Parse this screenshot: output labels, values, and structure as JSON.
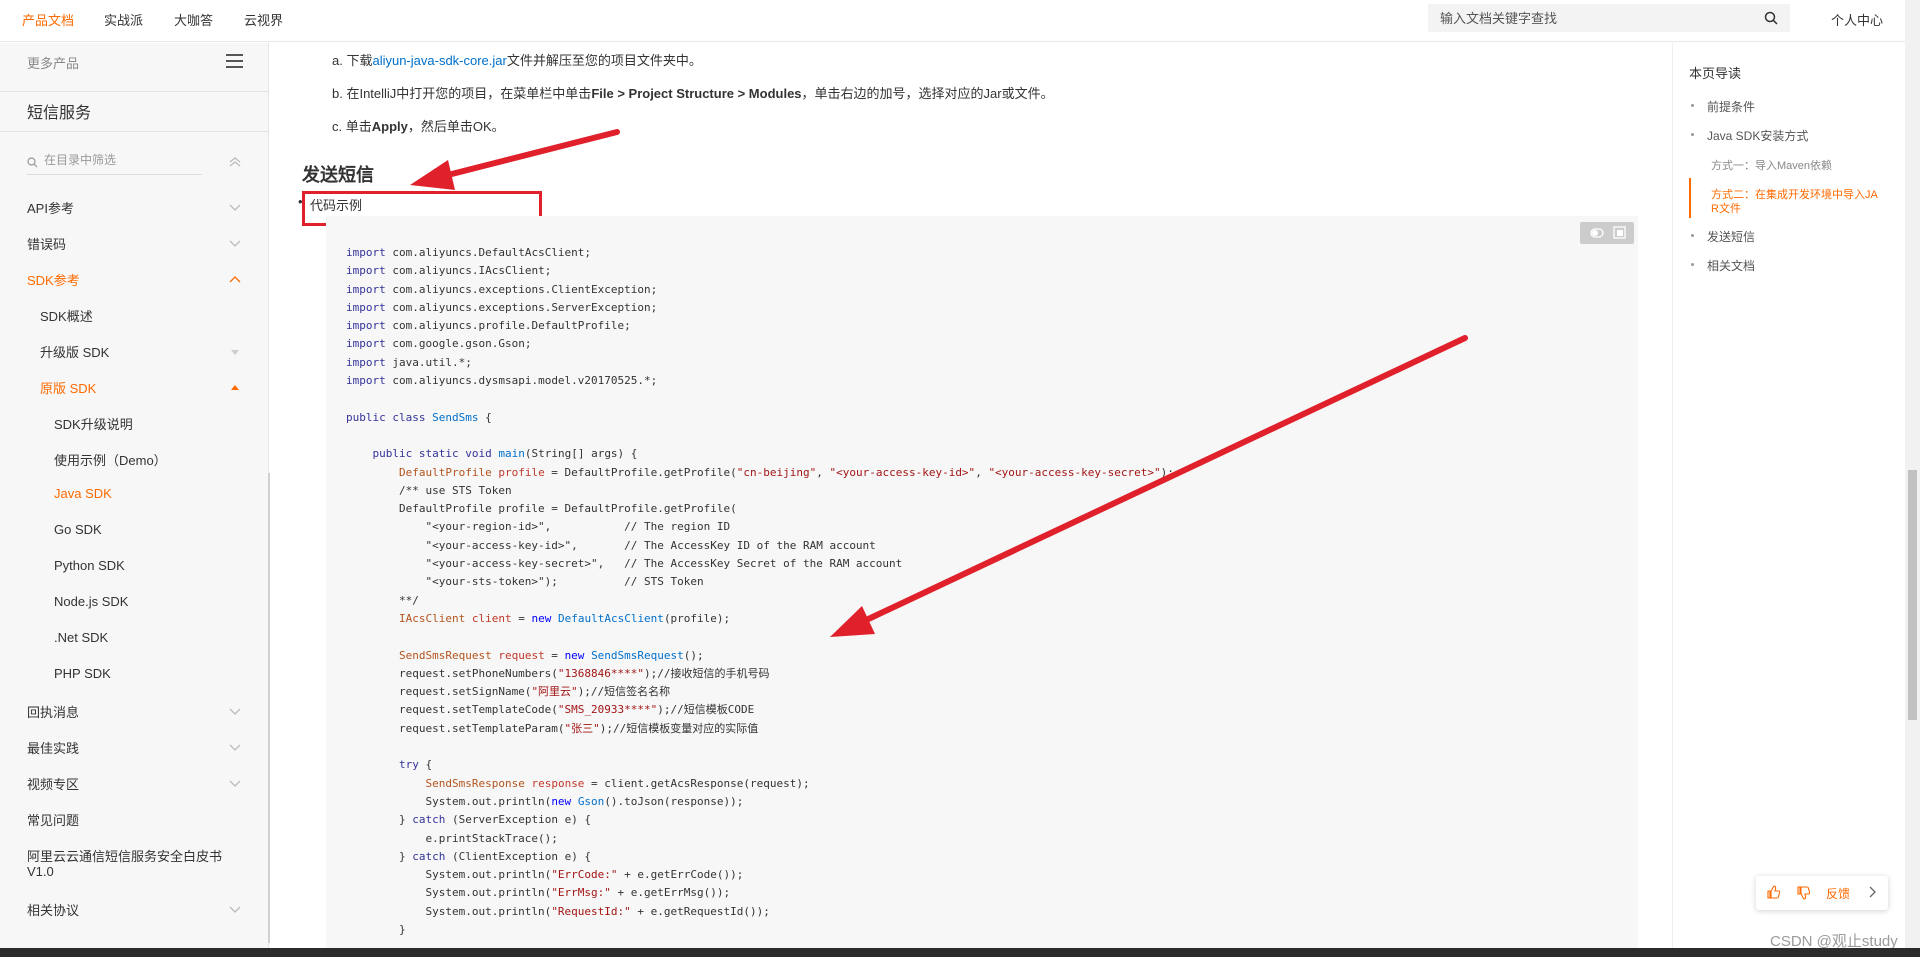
{
  "topnav": {
    "items": [
      "产品文档",
      "实战派",
      "大咖答",
      "云视界"
    ],
    "search_placeholder": "输入文档关键字查找",
    "personal": "个人中心"
  },
  "sidebar": {
    "more_products": "更多产品",
    "service_title": "短信服务",
    "filter_placeholder": "在目录中筛选",
    "items": [
      {
        "label": "API参考"
      },
      {
        "label": "错误码"
      },
      {
        "label": "SDK参考"
      },
      {
        "label": "SDK概述"
      },
      {
        "label": "升级版 SDK"
      },
      {
        "label": "原版 SDK"
      },
      {
        "label": "SDK升级说明"
      },
      {
        "label": "使用示例（Demo）"
      },
      {
        "label": "Java SDK"
      },
      {
        "label": "Go SDK"
      },
      {
        "label": "Python SDK"
      },
      {
        "label": "Node.js SDK"
      },
      {
        "label": ".Net SDK"
      },
      {
        "label": "PHP SDK"
      },
      {
        "label": "回执消息"
      },
      {
        "label": "最佳实践"
      },
      {
        "label": "视频专区"
      },
      {
        "label": "常见问题"
      },
      {
        "label": "阿里云云通信短信服务安全白皮书"
      },
      {
        "label": "V1.0"
      },
      {
        "label": "相关协议"
      }
    ]
  },
  "main": {
    "step_a_prefix": "a. 下载",
    "step_a_link": "aliyun-java-sdk-core.jar",
    "step_a_suffix": "文件并解压至您的项目文件夹中。",
    "step_b_prefix": "b. 在IntelliJ中打开您的项目，在菜单栏中单击",
    "step_b_bold": "File > Project Structure > Modules",
    "step_b_suffix": "，单击右边的加号，选择对应的Jar或文件。",
    "step_c_prefix": "c. 单击",
    "step_c_bold": "Apply",
    "step_c_suffix": "，然后单击OK。",
    "section_title": "发送短信",
    "bullet": "代码示例"
  },
  "toc": {
    "title": "本页导读",
    "items": [
      "前提条件",
      "Java SDK安装方式",
      "方式一：导入Maven依赖",
      "方式二：在集成开发环境中导入JA",
      "R文件",
      "发送短信",
      "相关文档"
    ]
  },
  "feedback": {
    "label": "反馈"
  },
  "watermark": "CSDN @观止study"
}
